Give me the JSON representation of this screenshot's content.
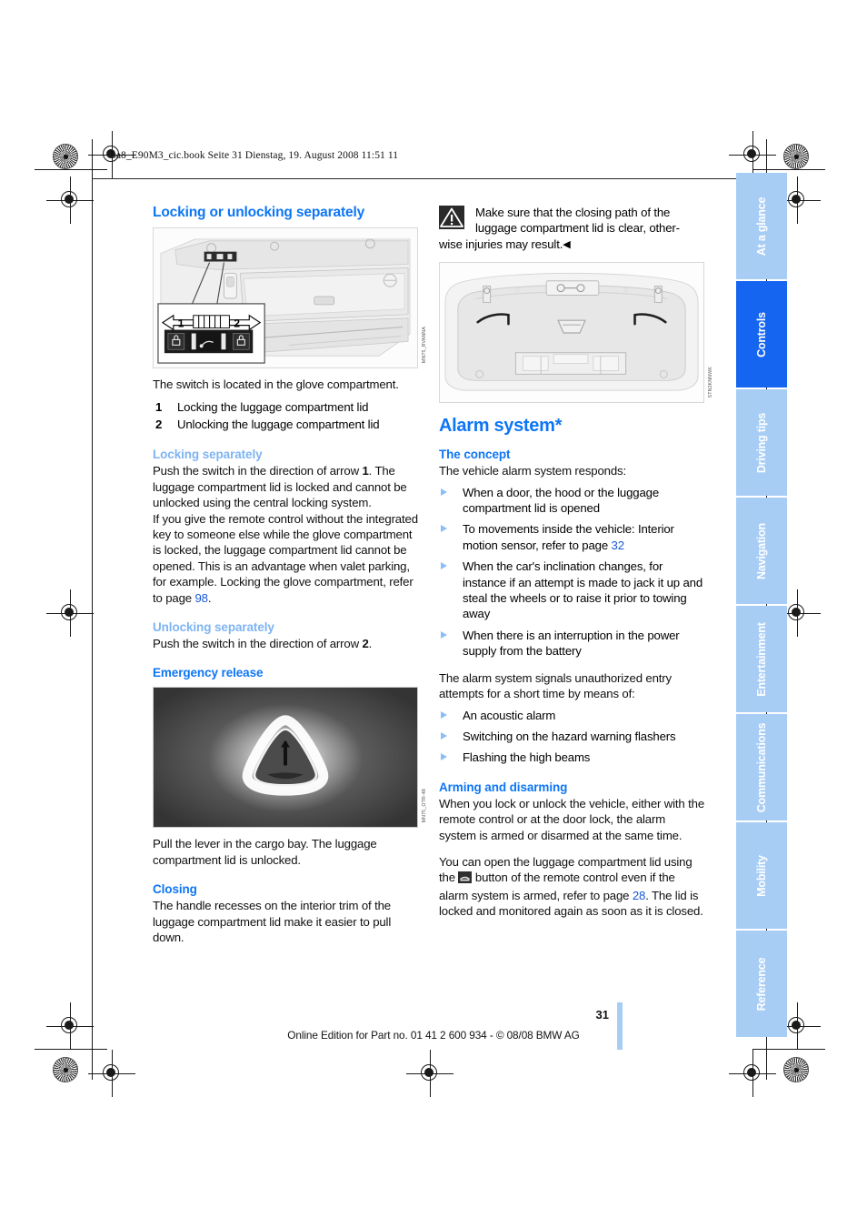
{
  "header": {
    "file_stamp": "ba8_E90M3_cic.book  Seite 31  Dienstag, 19. August 2008  11:51 11"
  },
  "left_column": {
    "heading": "Locking or unlocking separately",
    "figure_caption": "MN75_RVANNA",
    "intro": "The switch is located in the glove compartment.",
    "legend": [
      {
        "num": "1",
        "text": "Locking the luggage compartment lid"
      },
      {
        "num": "2",
        "text": "Unlocking the luggage compartment lid"
      }
    ],
    "locking_heading": "Locking separately",
    "locking_p1_a": "Push the switch in the direction of arrow ",
    "locking_p1_b": "1",
    "locking_p1_c": ". The luggage compartment lid is locked and cannot be unlocked using the central locking system.",
    "locking_p2_a": "If you give the remote control without the integrated key to someone else while the glove compartment is locked, the luggage compartment lid cannot be opened. This is an advantage when valet parking, for example. Locking the glove compartment, refer to page ",
    "locking_p2_page": "98",
    "locking_p2_end": ".",
    "unlocking_heading": "Unlocking separately",
    "unlocking_p_a": "Push the switch in the direction of arrow ",
    "unlocking_p_b": "2",
    "unlocking_p_c": ".",
    "emergency_heading": "Emergency release",
    "emergency_caption": "MN75_OTR-48",
    "emergency_text": "Pull the lever in the cargo bay. The luggage compartment lid is unlocked.",
    "closing_heading": "Closing",
    "closing_text": "The handle recesses on the interior trim of the luggage compartment lid make it easier to pull down."
  },
  "right_column": {
    "warning_icon": "warning-triangle-icon",
    "warning_line1": "Make sure that the closing path of the",
    "warning_line2": "luggage compartment lid is clear, other-",
    "warning_line3": "wise injuries may result.",
    "warning_end_mark": "◀",
    "figure_caption": "STN2KNNWK",
    "title": "Alarm system*",
    "concept_heading": "The concept",
    "concept_intro": "The vehicle alarm system responds:",
    "concept_bullets": [
      {
        "text": "When a door, the hood or the luggage compartment lid is opened"
      },
      {
        "text": "To movements inside the vehicle: Interior motion sensor, refer to page ",
        "page": "32"
      },
      {
        "text": "When the car's inclination changes, for instance if an attempt is made to jack it up and steal the wheels or to raise it prior to towing away"
      },
      {
        "text": "When there is an interruption in the power supply from the battery"
      }
    ],
    "signals_intro": "The alarm system signals unauthorized entry attempts for a short time by means of:",
    "signals_bullets": [
      {
        "text": "An acoustic alarm"
      },
      {
        "text": "Switching on the hazard warning flashers"
      },
      {
        "text": "Flashing the high beams"
      }
    ],
    "arming_heading": "Arming and disarming",
    "arming_p1": "When you lock or unlock the vehicle, either with the remote control or at the door lock, the alarm system is armed or disarmed at the same time.",
    "arming_p2_a": "You can open the luggage compartment lid using the ",
    "arming_p2_icon": "trunk-button-icon",
    "arming_p2_b": " button of the remote control even if the alarm system is armed, refer to page ",
    "arming_p2_page": "28",
    "arming_p2_c": ". The lid is locked and monitored again as soon as it is closed."
  },
  "tabs": [
    {
      "label": "At a glance",
      "active": false
    },
    {
      "label": "Controls",
      "active": true
    },
    {
      "label": "Driving tips",
      "active": false
    },
    {
      "label": "Navigation",
      "active": false
    },
    {
      "label": "Entertainment",
      "active": false
    },
    {
      "label": "Communications",
      "active": false
    },
    {
      "label": "Mobility",
      "active": false
    },
    {
      "label": "Reference",
      "active": false
    }
  ],
  "footer": {
    "page_number": "31",
    "online_edition": "Online Edition for Part no. 01 41 2 600 934 - © 08/08 BMW AG"
  },
  "colors": {
    "heading_blue": "#0d76f5",
    "sub_blue": "#7eb4f2",
    "tab_inactive": "#a8cdf5",
    "tab_active": "#1565f0",
    "link_blue": "#1758d8"
  }
}
